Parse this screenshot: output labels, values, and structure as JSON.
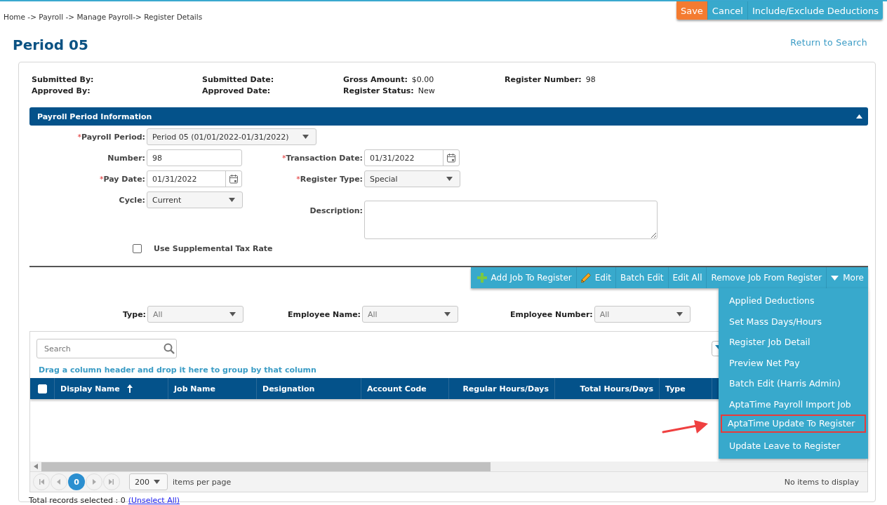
{
  "breadcrumb": "Home -> Payroll -> Manage Payroll-> Register Details",
  "actions": [
    {
      "label": "Save",
      "kind": "primary"
    },
    {
      "label": "Cancel",
      "kind": "secondary"
    },
    {
      "label": "Include/Exclude Deductions",
      "kind": "secondary"
    }
  ],
  "title": "Period 05",
  "return_link": "Return to Search",
  "summary_columns": [
    {
      "fields": [
        {
          "label": "Submitted By:"
        },
        {
          "label": "Approved By:"
        }
      ]
    },
    {
      "fields": [
        {
          "label": "Submitted Date:"
        },
        {
          "label": "Approved Date:"
        }
      ]
    },
    {
      "fields": [
        {
          "label": "Gross Amount:",
          "value": "$0.00"
        },
        {
          "label": "Register Status:",
          "value": "New"
        }
      ]
    },
    {
      "fields": [
        {
          "label": "Register Number:",
          "value": "98"
        }
      ]
    }
  ],
  "section": {
    "title": "Payroll Period Information",
    "expanded": true
  },
  "form_rows": [
    [
      {
        "required_mark": "*",
        "label": "Payroll Period:",
        "kind": "select",
        "value": "Period 05 (01/01/2022-01/31/2022)"
      }
    ],
    [
      {
        "label": "Number:",
        "kind": "text",
        "value": "98"
      },
      {
        "required_mark": "*",
        "label": "Transaction Date:",
        "kind": "date",
        "value": "01/31/2022"
      }
    ],
    [
      {
        "required_mark": "*",
        "label": "Pay Date:",
        "kind": "date",
        "value": "01/31/2022"
      },
      {
        "required_mark": "*",
        "label": "Register Type:",
        "kind": "select",
        "value": "Special"
      }
    ],
    [
      {
        "label": "Cycle:",
        "kind": "select",
        "value": "Current"
      },
      {
        "label": "Description:",
        "kind": "textarea"
      }
    ]
  ],
  "supplemental": {
    "label": "Use Supplemental Tax Rate",
    "checked": false
  },
  "toolbar": [
    {
      "label": "Add Job To Register",
      "kind": "plus"
    },
    {
      "label": "Edit",
      "kind": "pencil"
    },
    {
      "label": "Batch Edit",
      "kind": "plain"
    },
    {
      "label": "Edit All",
      "kind": "plain"
    },
    {
      "label": "Remove Job From Register",
      "kind": "plain"
    },
    {
      "label": "More",
      "kind": "menu",
      "expanded": true
    }
  ],
  "more_menu": [
    {
      "label": "Applied Deductions",
      "highlighted": false
    },
    {
      "label": "Set Mass Days/Hours",
      "highlighted": false
    },
    {
      "label": "Register Job Detail",
      "highlighted": false
    },
    {
      "label": "Preview Net Pay",
      "highlighted": false
    },
    {
      "label": "Batch Edit (Harris Admin)",
      "highlighted": false
    },
    {
      "label": "AptaTime Payroll Import Job",
      "highlighted": false
    },
    {
      "label": "AptaTime Update To Register",
      "highlighted": true
    },
    {
      "label": "Update Leave to Register",
      "highlighted": false
    }
  ],
  "filters": [
    {
      "label": "Type:",
      "value": "All"
    },
    {
      "label": "Employee Name:",
      "value": "All"
    },
    {
      "label": "Employee Number:",
      "value": "All"
    }
  ],
  "grid": {
    "search": {
      "placeholder": "Search"
    },
    "group_hint": "Drag a column header and drop it here to group by that column",
    "select_all": {
      "checked": false
    },
    "columns": [
      {
        "label": "Display Name",
        "sorted": true
      },
      {
        "label": "Job Name",
        "sorted": false
      },
      {
        "label": "Designation",
        "sorted": false
      },
      {
        "label": "Account Code",
        "sorted": false
      },
      {
        "label": "Regular Hours/Days",
        "sorted": false
      },
      {
        "label": "Total Hours/Days",
        "sorted": false
      },
      {
        "label": "Type",
        "sorted": false
      }
    ],
    "pager": {
      "page": "0",
      "page_size": "200",
      "per_page_label": "items per page",
      "status": "No items to display"
    }
  },
  "selection": {
    "text": "Total records selected : 0",
    "link": "(Unselect All)"
  }
}
